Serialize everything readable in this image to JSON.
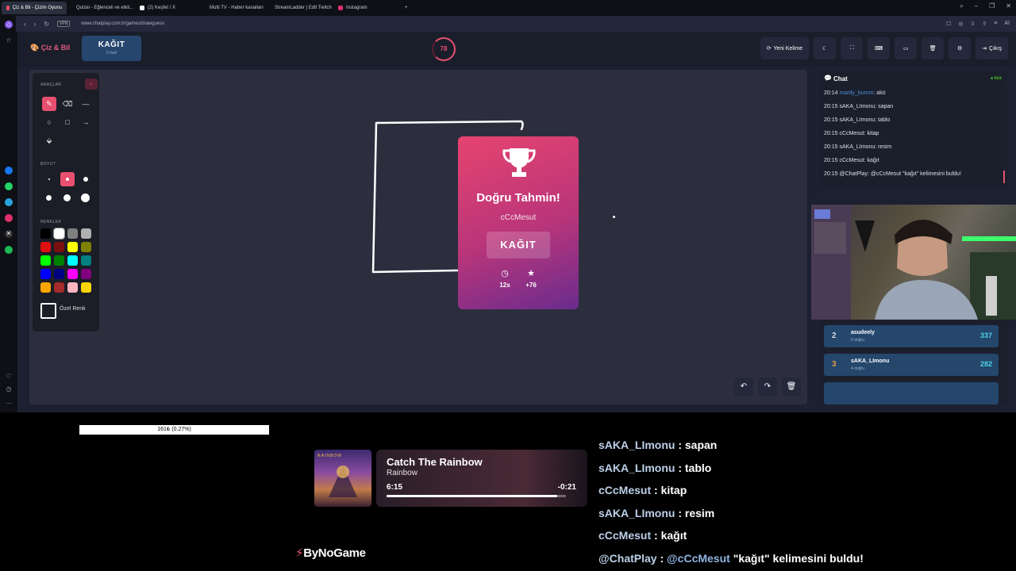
{
  "browser": {
    "tabs": [
      {
        "label": "Çiz & Bil - Çizim Oyunu",
        "color": "#e8506f",
        "active": true
      },
      {
        "label": "Quizei - Eğlenceli ve etkil...",
        "color": "#f2b632",
        "active": false
      },
      {
        "label": "(2) Keşfet / X",
        "color": "#ffffff",
        "active": false
      },
      {
        "label": "Multi TV - Haber kanalları ...",
        "color": "#cccccc",
        "active": false
      },
      {
        "label": "StreamLadder | Edit Twitch...",
        "color": "#5865f2",
        "active": false
      },
      {
        "label": "Instagram",
        "color": "#e1306c",
        "active": false
      }
    ],
    "new_tab": "+",
    "vpn_label": "VPN",
    "url": "www.chatplay.com.tr/games/drawguess",
    "ai_label": "AI"
  },
  "header": {
    "logo": "Çiz & Bil",
    "word": "KAĞIT",
    "word_count": "5 harf",
    "timer": "78",
    "buttons": {
      "new_word": "Yeni Kelime",
      "exit": "Çıkış"
    }
  },
  "tools": {
    "section_tools": "ARAÇLAR",
    "section_size": "BOYUT",
    "section_colors": "RENKLER",
    "custom_color_label": "Özel Renk",
    "colors": [
      "#000000",
      "#ffffff",
      "#808080",
      "#b0b0b0",
      "#e01010",
      "#7a1010",
      "#ffff00",
      "#808000",
      "#00ff00",
      "#008000",
      "#00ffff",
      "#008080",
      "#0000ff",
      "#000080",
      "#ff00ff",
      "#800080",
      "#ffa500",
      "#a52a2a",
      "#ffb6c1",
      "#ffd700"
    ]
  },
  "result_card": {
    "title": "Doğru Tahmin!",
    "user": "cCcMesut",
    "word": "KAĞIT",
    "time": "12s",
    "points": "+76"
  },
  "chat": {
    "title": "Chat",
    "platform": "Kick",
    "messages": [
      {
        "time": "20:14",
        "user": "mardy_bumm",
        "text": ": akü",
        "user_blue": true
      },
      {
        "time": "20:15",
        "user": "sAKA_LImonu",
        "text": ": sapan"
      },
      {
        "time": "20:15",
        "user": "sAKA_LImonu",
        "text": ": tablo"
      },
      {
        "time": "20:15",
        "user": "cCcMesut",
        "text": ": kitap"
      },
      {
        "time": "20:15",
        "user": "sAKA_LImonu",
        "text": ": resim"
      },
      {
        "time": "20:15",
        "user": "cCcMesut",
        "text": ": kağıt"
      },
      {
        "time": "20:15",
        "user": "@ChatPlay",
        "text": ": @cCcMesut \"kağıt\" kelimesini buldu!"
      }
    ]
  },
  "leaderboard": [
    {
      "rank": "2",
      "name": "asudeely",
      "sub": "6 doğru",
      "points": "337",
      "rank_color": "#cfd6e0"
    },
    {
      "rank": "3",
      "name": "sAKA_LImonu",
      "sub": "4 doğru",
      "points": "282",
      "rank_color": "#e39a4a"
    }
  ],
  "overlay": {
    "donation": "161₺ (0.27%)",
    "donation_progress": 0.0027,
    "now_playing": {
      "song": "Catch The Rainbow",
      "artist": "Rainbow",
      "current": "6:15",
      "remaining": "-0:21",
      "progress": 0.95,
      "album_text": "RAINBOW"
    },
    "brand": "ByNoGame",
    "chat": [
      {
        "user": "sAKA_LImonu",
        "text": " : sapan"
      },
      {
        "user": "sAKA_LImonu",
        "text": " : tablo"
      },
      {
        "user": "cCcMesut",
        "text": " : kitap"
      },
      {
        "user": "sAKA_LImonu",
        "text": " : resim"
      },
      {
        "user": "cCcMesut",
        "text": " : kağıt"
      },
      {
        "user": "@ChatPlay",
        "mention": "@cCcMesut",
        "text": " \"kağıt\" kelimesini buldu!"
      }
    ]
  }
}
